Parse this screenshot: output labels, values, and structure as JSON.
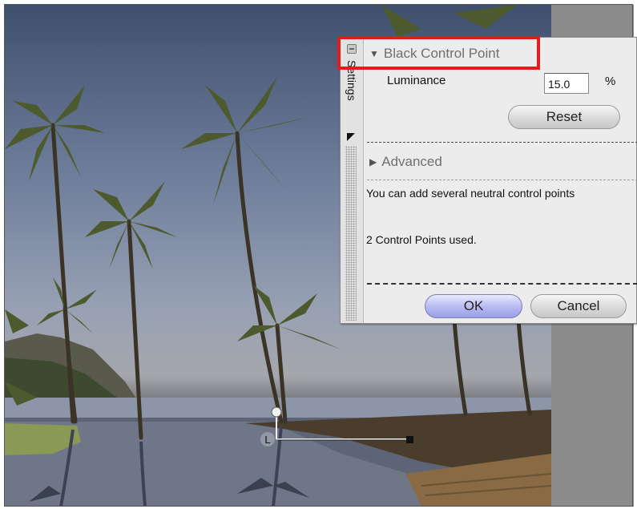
{
  "panel": {
    "side_tab_label": "Settings",
    "black_control_point": {
      "title": "Black Control Point",
      "luminance_label": "Luminance",
      "luminance_value": "15.0",
      "luminance_unit": "%",
      "reset_label": "Reset"
    },
    "advanced": {
      "title": "Advanced"
    },
    "info_text": "You can add several neutral control points",
    "control_points_used": "2 Control Points used.",
    "ok_label": "OK",
    "cancel_label": "Cancel"
  },
  "canvas": {
    "control_point_letter": "L"
  },
  "colors": {
    "highlight": "#e41b1b",
    "ok_button": "#b9bcf2",
    "panel_bg": "#ececec"
  }
}
